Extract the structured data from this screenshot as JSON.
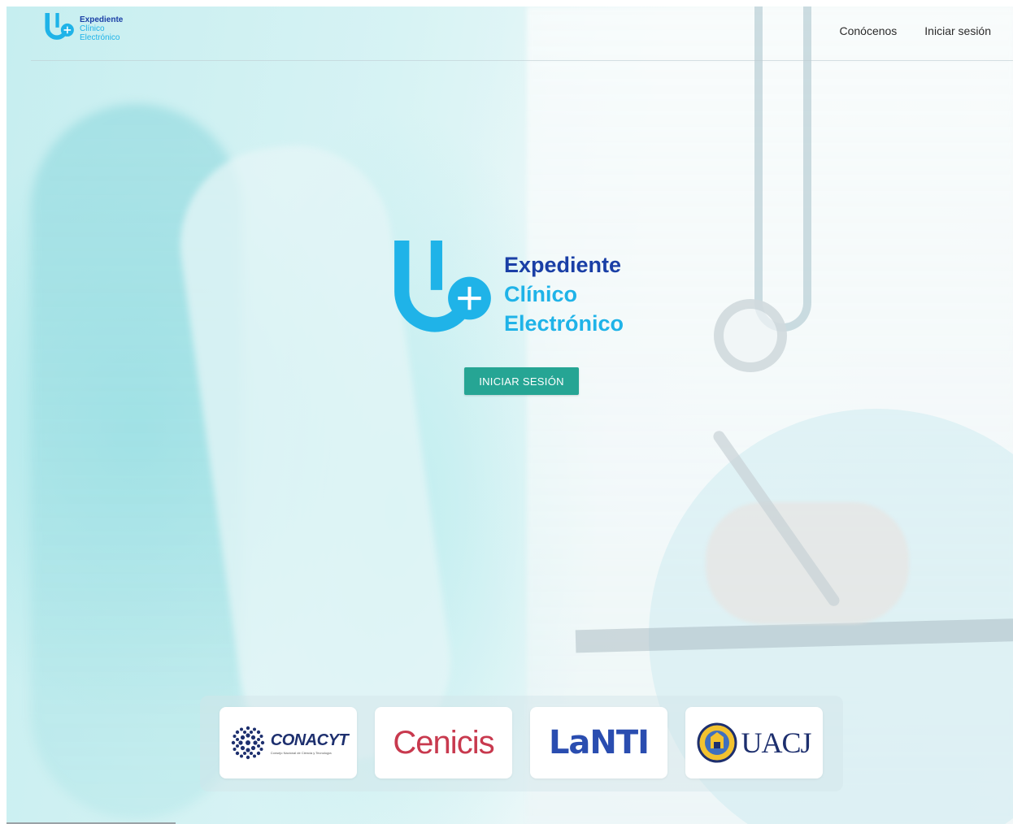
{
  "brand": {
    "line1": "Expediente",
    "line2": "Clínico",
    "line3": "Electrónico"
  },
  "nav": {
    "about_label": "Conócenos",
    "login_label": "Iniciar sesión"
  },
  "hero": {
    "title_line1": "Expediente",
    "title_line2": "Clínico",
    "title_line3": "Electrónico",
    "cta_label": "INICIAR SESIÓN"
  },
  "partners": [
    {
      "name": "CONACYT",
      "subtitle": "Consejo Nacional de Ciencia y Tecnología",
      "icon": "conacyt-dots-logo"
    },
    {
      "name": "Cenicis"
    },
    {
      "name": "LaNTI"
    },
    {
      "name": "UACJ",
      "icon": "uacj-seal-logo"
    }
  ],
  "colors": {
    "brand_dark": "#1a3fa6",
    "brand_light": "#1fb3e8",
    "cta": "#26a594",
    "cenicis": "#c8394e",
    "lanti": "#2a4db0"
  }
}
